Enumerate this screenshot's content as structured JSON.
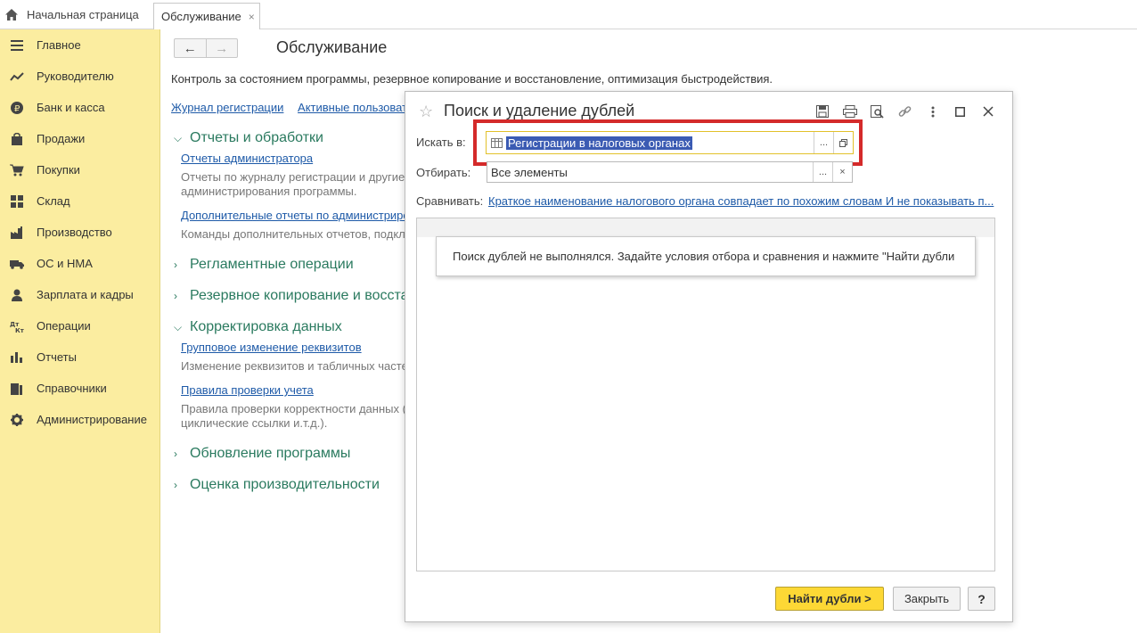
{
  "tabs": {
    "home": "Начальная страница",
    "active": "Обслуживание",
    "active_close": "×"
  },
  "sidebar": {
    "items": [
      {
        "label": "Главное",
        "icon": "menu-lines-icon"
      },
      {
        "label": "Руководителю",
        "icon": "trend-chart-icon"
      },
      {
        "label": "Банк и касса",
        "icon": "ruble-coin-icon"
      },
      {
        "label": "Продажи",
        "icon": "shopping-bag-icon"
      },
      {
        "label": "Покупки",
        "icon": "shopping-cart-icon"
      },
      {
        "label": "Склад",
        "icon": "warehouse-grid-icon"
      },
      {
        "label": "Производство",
        "icon": "factory-icon"
      },
      {
        "label": "ОС и НМА",
        "icon": "truck-icon"
      },
      {
        "label": "Зарплата и кадры",
        "icon": "person-icon"
      },
      {
        "label": "Операции",
        "icon": "dt-kt-icon"
      },
      {
        "label": "Отчеты",
        "icon": "bar-chart-icon"
      },
      {
        "label": "Справочники",
        "icon": "books-icon"
      },
      {
        "label": "Администрирование",
        "icon": "gear-icon"
      }
    ]
  },
  "main": {
    "title": "Обслуживание",
    "description": "Контроль за состоянием программы, резервное копирование и восстановление, оптимизация быстродействия.",
    "top_links": [
      "Журнал регистрации",
      "Активные пользовате"
    ],
    "sections": [
      {
        "label": "Отчеты и обработки",
        "expanded": true
      },
      {
        "label": "Регламентные операции",
        "expanded": false
      },
      {
        "label": "Резервное копирование и восста",
        "expanded": false
      },
      {
        "label": "Корректировка данных",
        "expanded": true
      },
      {
        "label": "Обновление программы",
        "expanded": false
      },
      {
        "label": "Оценка производительности",
        "expanded": false
      }
    ],
    "items": {
      "admin_reports_link": "Отчеты администратора",
      "admin_reports_desc": "Отчеты по журналу регистрации и другие\nадминистрирования программы.",
      "extra_reports_link": "Дополнительные отчеты по администриро",
      "extra_reports_desc": "Команды дополнительных отчетов, подкл",
      "group_change_link": "Групповое изменение реквизитов",
      "group_change_desc": "Изменение реквизитов и табличных часте",
      "check_rules_link": "Правила проверки учета",
      "check_rules_desc": "Правила проверки корректности данных (\nциклические ссылки и.т.д.)."
    }
  },
  "dialog": {
    "title": "Поиск и удаление дублей",
    "search_in_label": "Искать в:",
    "search_in_value": "Регистрации в налоговых органах",
    "filter_label": "Отбирать:",
    "filter_value": "Все элементы",
    "compare_label": "Сравнивать:",
    "compare_value": "Краткое наименование налогового органа совпадает по похожим словам И не показывать п...",
    "message": "Поиск дублей не выполнялся.  Задайте условия отбора и сравнения и нажмите \"Найти дубли",
    "find_button": "Найти дубли >",
    "close_button": "Закрыть",
    "help_button": "?",
    "ellipsis": "...",
    "clear": "×"
  },
  "colors": {
    "sidebar_bg": "#fbeda0",
    "section_green": "#2a7a5f",
    "link_blue": "#1e5aa8",
    "highlight_red": "#d42a2a",
    "primary_button": "#fdd835"
  }
}
